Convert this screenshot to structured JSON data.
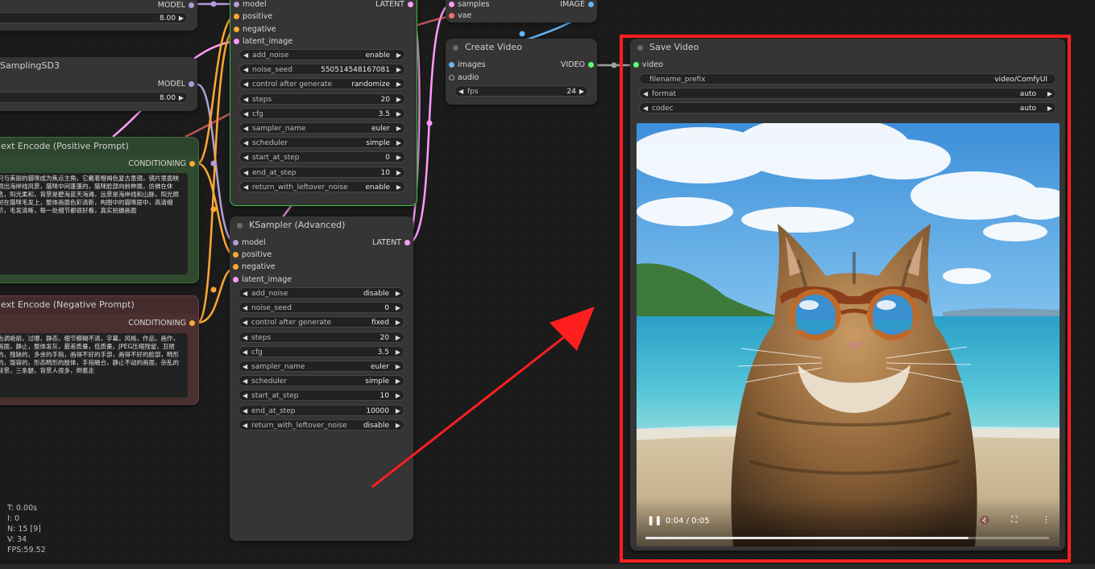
{
  "nodes": {
    "top_left": {
      "output": "MODEL",
      "widget_value": "8.00"
    },
    "sampling_sd3": {
      "title": "SamplingSD3",
      "output": "MODEL",
      "widget_value": "8.00"
    },
    "positive_prompt": {
      "title": "ext Encode (Positive Prompt)",
      "output": "CONDITIONING",
      "text": "只与美丽的猫咪成为焦点主角，它戴着橙褐色复古墨镜，镜片里面映照出海岸线风景，猫咪中间蓬蓬的，猫咪脸部向前伸展，仿佛在休息，阳光柔和，背景是碧海蓝天海滩，远景是海岸线和山脉，阳光照射在猫咪毛发上，整体画面色彩清新，构图中的猫咪居中，高清细节，毛发清晰，每一处细节都很好看，真实拍摄画面"
    },
    "negative_prompt": {
      "title": "ext Encode (Negative Prompt)",
      "output": "CONDITIONING",
      "text": "色调艳丽，过曝，静态，细节模糊不清，字幕，风格，作品，画作，画面，静止，整体发灰，最差质量，低质量，JPEG压缩残留，丑陋的，残缺的，多余的手指，画得不好的手部，画得不好的脸部，畸形的，毁容的，形态畸形的肢体，手指融合，静止不动的画面，杂乱的背景，三条腿，背景人很多，倒着走"
    },
    "ksampler_top": {
      "inputs": [
        "model",
        "positive",
        "negative",
        "latent_image"
      ],
      "output": "LATENT",
      "widgets": [
        {
          "label": "add_noise",
          "value": "enable"
        },
        {
          "label": "noise_seed",
          "value": "550514548167081"
        },
        {
          "label": "control after generate",
          "value": "randomize"
        },
        {
          "label": "steps",
          "value": "20"
        },
        {
          "label": "cfg",
          "value": "3.5"
        },
        {
          "label": "sampler_name",
          "value": "euler"
        },
        {
          "label": "scheduler",
          "value": "simple"
        },
        {
          "label": "start_at_step",
          "value": "0"
        },
        {
          "label": "end_at_step",
          "value": "10"
        },
        {
          "label": "return_with_leftover_noise",
          "value": "enable"
        }
      ]
    },
    "ksampler_adv": {
      "title": "KSampler (Advanced)",
      "inputs": [
        "model",
        "positive",
        "negative",
        "latent_image"
      ],
      "output": "LATENT",
      "widgets": [
        {
          "label": "add_noise",
          "value": "disable"
        },
        {
          "label": "noise_seed",
          "value": "0"
        },
        {
          "label": "control after generate",
          "value": "fixed"
        },
        {
          "label": "steps",
          "value": "20"
        },
        {
          "label": "cfg",
          "value": "3.5"
        },
        {
          "label": "sampler_name",
          "value": "euler"
        },
        {
          "label": "scheduler",
          "value": "simple"
        },
        {
          "label": "start_at_step",
          "value": "10"
        },
        {
          "label": "end_at_step",
          "value": "10000"
        },
        {
          "label": "return_with_leftover_noise",
          "value": "disable"
        }
      ]
    },
    "vae_decode": {
      "inputs": [
        "samples",
        "vae"
      ],
      "output": "IMAGE"
    },
    "create_video": {
      "title": "Create Video",
      "inputs": [
        "images",
        "audio"
      ],
      "output": "VIDEO",
      "fps_label": "fps",
      "fps_value": "24"
    },
    "save_video": {
      "title": "Save Video",
      "input": "video",
      "widgets": [
        {
          "label": "filename_prefix",
          "value": "video/ComfyUI"
        },
        {
          "label": "format",
          "value": "auto"
        },
        {
          "label": "codec",
          "value": "auto"
        }
      ],
      "video_time": "0:04 / 0:05",
      "video_progress": 0.8
    }
  },
  "stats": {
    "t": "T: 0.00s",
    "i": "I: 0",
    "n": "N: 15 [9]",
    "v": "V: 34",
    "fps": "FPS:59.52"
  },
  "colors": {
    "model_pin": "#b39ddb",
    "conditioning_pin": "#ffa931",
    "latent_pin": "#ff9cf9",
    "vae_pin": "#ff6e6e",
    "image_pin": "#64b5f6",
    "video_pin": "#5bfc79",
    "highlight": "#ff1f1f"
  }
}
